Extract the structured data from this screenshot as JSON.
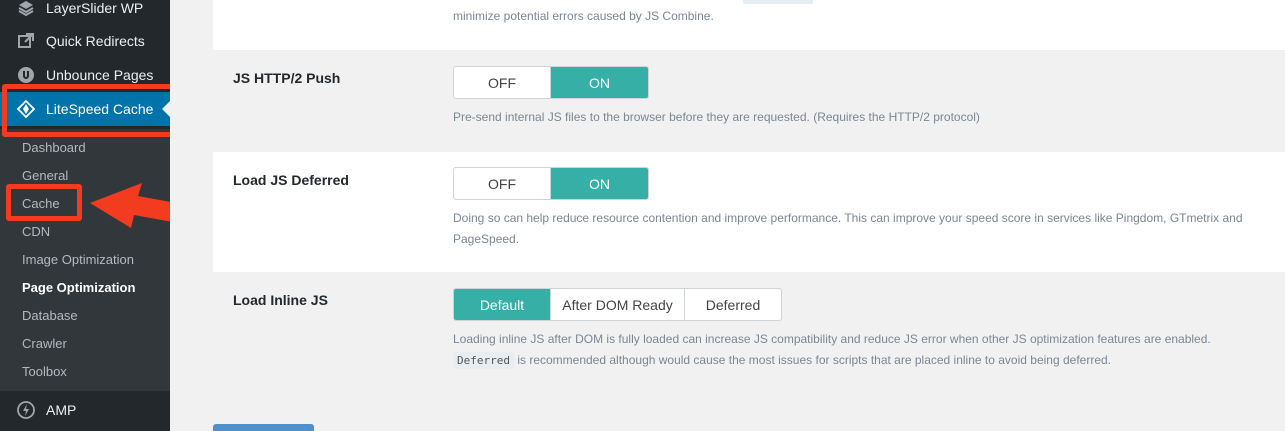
{
  "sidebar": {
    "menu": [
      {
        "label": "LayerSlider WP",
        "icon": "layers-icon"
      },
      {
        "label": "Quick Redirects",
        "icon": "external-link-icon"
      },
      {
        "label": "Unbounce Pages",
        "icon": "unbounce-icon"
      },
      {
        "label": "LiteSpeed Cache",
        "icon": "litespeed-diamond-icon",
        "active": true
      }
    ],
    "submenu": [
      {
        "label": "Dashboard"
      },
      {
        "label": "General"
      },
      {
        "label": "Cache",
        "highlighted": true
      },
      {
        "label": "CDN"
      },
      {
        "label": "Image Optimization"
      },
      {
        "label": "Page Optimization",
        "current": true
      },
      {
        "label": "Database"
      },
      {
        "label": "Crawler"
      },
      {
        "label": "Toolbox"
      }
    ],
    "amp": {
      "label": "AMP",
      "icon": "amp-bolt-icon"
    }
  },
  "annotation_color": "#f33b1f",
  "accent_color": "#36b0a7",
  "settings": {
    "top_fragment": "minimize potential errors caused by JS Combine.",
    "js_http2_push": {
      "label": "JS HTTP/2 Push",
      "options": [
        "OFF",
        "ON"
      ],
      "selected": "ON",
      "description": "Pre-send internal JS files to the browser before they are requested. (Requires the HTTP/2 protocol)"
    },
    "load_js_deferred": {
      "label": "Load JS Deferred",
      "options": [
        "OFF",
        "ON"
      ],
      "selected": "ON",
      "description_line1": "Doing so can help reduce resource contention and improve performance. This can improve your speed score in services like Pingdom, GTmetrix and",
      "description_line2": "PageSpeed."
    },
    "load_inline_js": {
      "label": "Load Inline JS",
      "options": [
        "Default",
        "After DOM Ready",
        "Deferred"
      ],
      "selected": "Default",
      "description_line1": "Loading inline JS after DOM is fully loaded can increase JS compatibility and reduce JS error when other JS optimization features are enabled.",
      "code_chip": "Deferred",
      "description_line2": "is recommended although would cause the most issues for scripts that are placed inline to avoid being deferred."
    }
  }
}
